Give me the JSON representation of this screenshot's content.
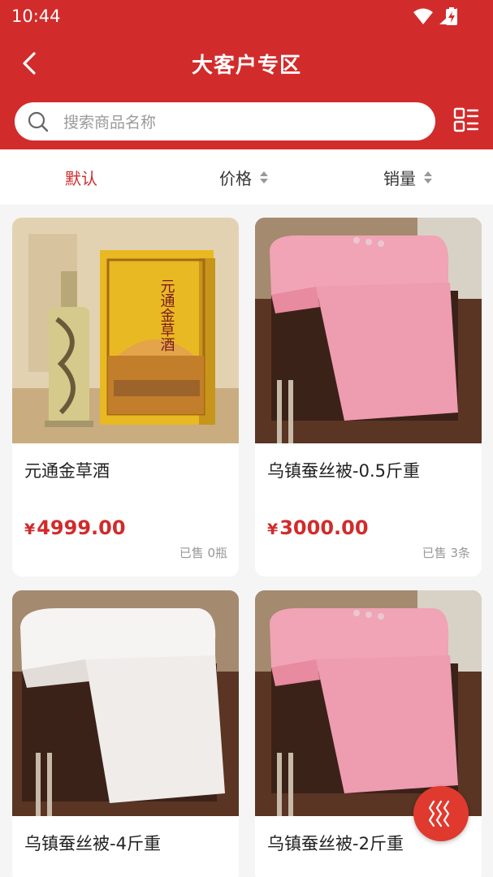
{
  "status_bar": {
    "time": "10:44"
  },
  "header": {
    "title": "大客户专区"
  },
  "search": {
    "placeholder": "搜索商品名称"
  },
  "sort": {
    "default_label": "默认",
    "price_label": "价格",
    "sales_label": "销量"
  },
  "products": [
    {
      "name": "元通金草酒",
      "currency": "¥",
      "price": "4999.00",
      "sold": "已售 0瓶"
    },
    {
      "name": "乌镇蚕丝被-0.5斤重",
      "currency": "¥",
      "price": "3000.00",
      "sold": "已售 3条"
    },
    {
      "name": "乌镇蚕丝被-4斤重"
    },
    {
      "name": "乌镇蚕丝被-2斤重"
    }
  ],
  "images": {
    "liquor_box_text": "元通金草酒"
  },
  "colors": {
    "brand": "#d22b2b",
    "price": "#d22b2b",
    "fab": "#e03a2f"
  },
  "icons": {
    "back": "back-arrow-icon",
    "search": "search-icon",
    "layout": "grid-list-icon",
    "fab": "wave-icon"
  }
}
